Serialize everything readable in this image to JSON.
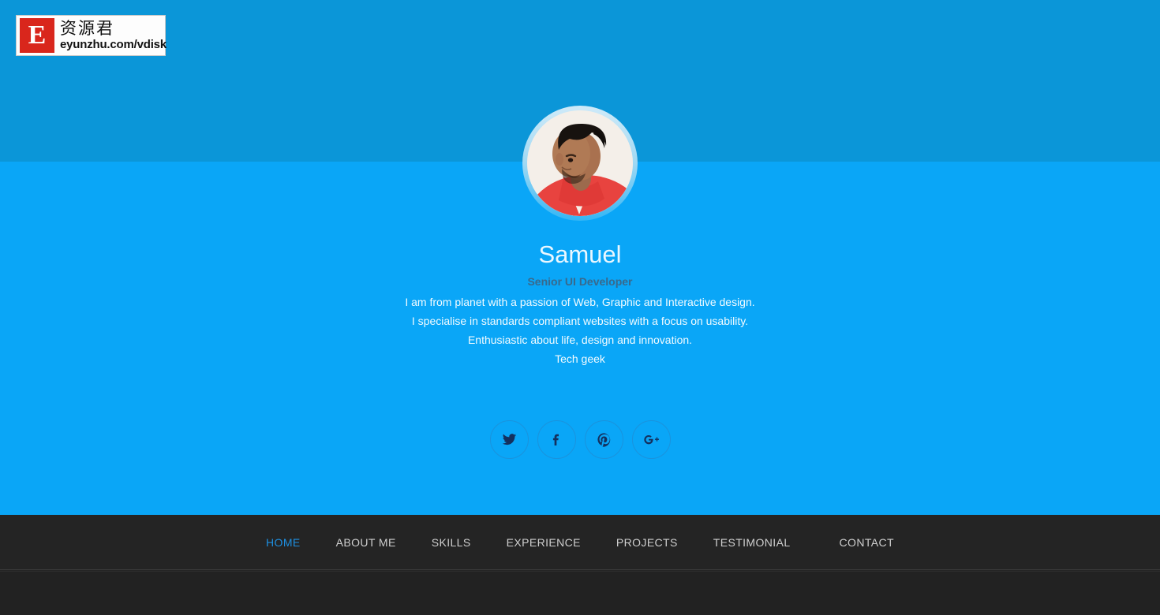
{
  "watermark": {
    "badge_letter": "E",
    "cn_text": "资源君",
    "url_text": "eyunzhu.com/vdisk"
  },
  "profile": {
    "avatar_alt": "profile-photo",
    "name": "Samuel",
    "role": "Senior UI Developer",
    "bio_lines": [
      "I am from planet with a passion of Web, Graphic and Interactive design.",
      "I specialise in standards compliant websites with a focus on usability.",
      "Enthusiastic about life, design and innovation.",
      "Tech geek"
    ]
  },
  "social": {
    "items": [
      {
        "icon": "twitter-icon",
        "label": "Twitter"
      },
      {
        "icon": "facebook-icon",
        "label": "Facebook"
      },
      {
        "icon": "pinterest-icon",
        "label": "Pinterest"
      },
      {
        "icon": "google-plus-icon",
        "label": "Google Plus"
      }
    ]
  },
  "nav": {
    "items": [
      {
        "label": "HOME",
        "active": true
      },
      {
        "label": "ABOUT ME",
        "active": false
      },
      {
        "label": "SKILLS",
        "active": false
      },
      {
        "label": "EXPERIENCE",
        "active": false
      },
      {
        "label": "PROJECTS",
        "active": false
      },
      {
        "label": "TESTIMONIAL",
        "active": false
      },
      {
        "label": "CONTACT",
        "active": false
      }
    ]
  },
  "colors": {
    "hero_top": "#0b96d8",
    "hero_bottom": "#0aa6f7",
    "nav_bg": "#242424",
    "nav_active": "#1e8fe0",
    "accent_red": "#d9261c"
  }
}
